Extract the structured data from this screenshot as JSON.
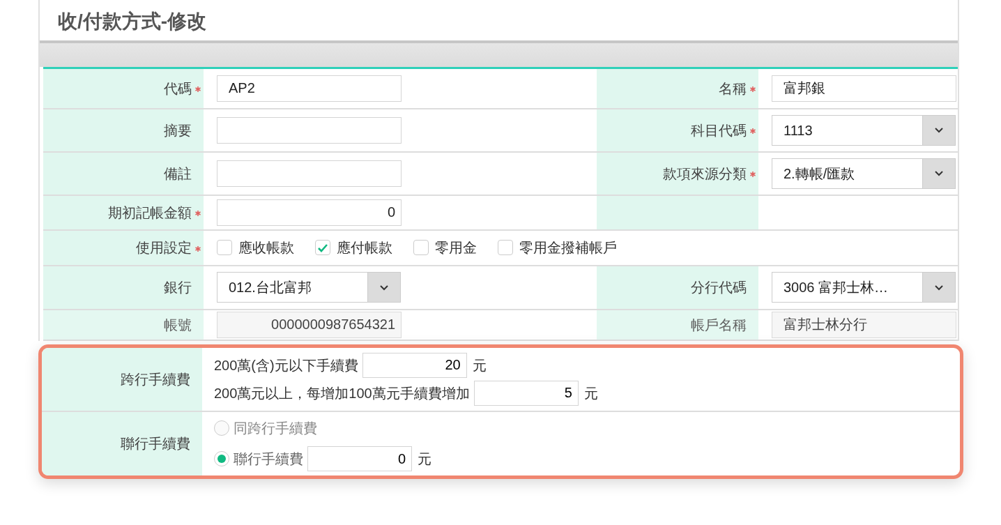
{
  "title": "收/付款方式-修改",
  "rows": [
    {
      "cells": [
        {
          "label": "代碼",
          "required": true,
          "field": {
            "kind": "text",
            "value": "AP2"
          }
        },
        {
          "label": "名稱",
          "required": true,
          "field": {
            "kind": "text",
            "value": "富邦銀"
          }
        }
      ]
    },
    {
      "cells": [
        {
          "label": "摘要",
          "required": false,
          "field": {
            "kind": "text"
          }
        },
        {
          "label": "科目代碼",
          "required": true,
          "field": {
            "kind": "select",
            "value": "1113"
          }
        }
      ]
    },
    {
      "cells": [
        {
          "label": "備註",
          "required": false,
          "field": {
            "kind": "text"
          }
        },
        {
          "label": "款項來源分類",
          "required": true,
          "field": {
            "kind": "select",
            "value": "2.轉帳/匯款"
          }
        }
      ]
    },
    {
      "cells": [
        {
          "label": "期初記帳金額",
          "required": true,
          "field": {
            "kind": "number",
            "value": "0"
          }
        },
        {
          "field": {
            "kind": "none"
          }
        }
      ]
    },
    {
      "cells": [
        {
          "label": "使用設定",
          "required": true,
          "field": {
            "kind": "checks",
            "options": [
              {
                "label": "應收帳款",
                "checked": false
              },
              {
                "label": "應付帳款",
                "checked": true
              },
              {
                "label": "零用金",
                "checked": false
              },
              {
                "label": "零用金撥補帳戶",
                "checked": false
              }
            ]
          }
        }
      ]
    },
    {
      "cells": [
        {
          "label": "銀行",
          "required": false,
          "field": {
            "kind": "select",
            "value": "012.台北富邦"
          }
        },
        {
          "label": "分行代碼",
          "required": false,
          "field": {
            "kind": "select",
            "value": "3006 富邦士林…"
          }
        }
      ]
    },
    {
      "cells": [
        {
          "label": "帳號",
          "required": false,
          "field": {
            "kind": "readonly-number",
            "value": "0000000987654321"
          }
        },
        {
          "label": "帳戶名稱",
          "required": false,
          "field": {
            "kind": "readonly",
            "value": "富邦士林分行"
          }
        }
      ]
    }
  ],
  "fees": [
    {
      "label": "跨行手續費",
      "kind": "lines",
      "lines": [
        {
          "text": "200萬(含)元以下手續費",
          "value": "20",
          "unit": "元"
        },
        {
          "text": "200萬元以上，每增加100萬元手續費增加",
          "value": "5",
          "unit": "元"
        }
      ]
    },
    {
      "label": "聯行手續費",
      "kind": "radios",
      "options": [
        {
          "label": "同跨行手續費",
          "selected": false
        },
        {
          "label": "聯行手續費",
          "selected": true,
          "value": "0",
          "unit": "元"
        }
      ]
    }
  ]
}
